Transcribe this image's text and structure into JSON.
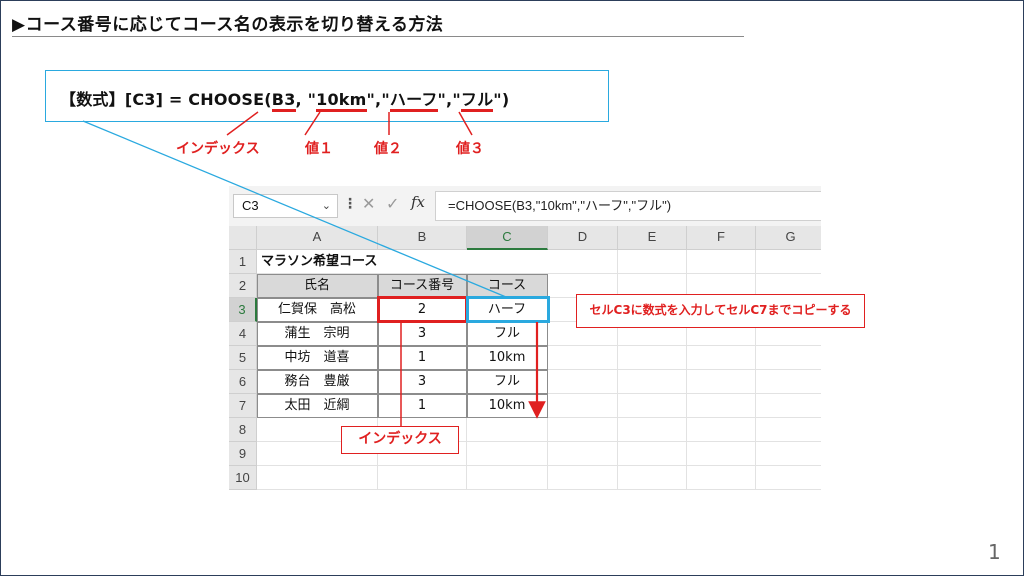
{
  "slide": {
    "title": "▶コース番号に応じてコース名の表示を切り替える方法",
    "page_number": "1"
  },
  "formula": {
    "label": "【数式】",
    "cell_ref": "[C3]",
    "equals": " = ",
    "func": "CHOOSE(",
    "arg1": "B3",
    "sep1": ", \"",
    "arg2": "10km",
    "sep2": "\",\"",
    "arg3": "ハーフ",
    "sep3": "\",\"",
    "arg4": "フル",
    "close": "\")"
  },
  "callouts": {
    "index": "インデックス",
    "value1": "値１",
    "value2": "値２",
    "value3": "値３",
    "copy_note": "セルC3に数式を入力してセルC7までコピーする",
    "index_box": "インデックス"
  },
  "colors": {
    "accent_red": "#e02020",
    "accent_blue": "#2aa9df",
    "excel_green": "#2c7a3e"
  },
  "excel": {
    "name_box": "C3",
    "name_box_dropdown_icon": "chevron-down-icon",
    "formula_bar_text": "=CHOOSE(B3,\"10km\",\"ハーフ\",\"フル\")",
    "fx_label": "fx",
    "cancel_glyph": "✕",
    "enter_glyph": "✓",
    "more_glyph": "⋮",
    "columns": [
      "A",
      "B",
      "C",
      "D",
      "E",
      "F",
      "G"
    ],
    "rows": [
      "1",
      "2",
      "3",
      "4",
      "5",
      "6",
      "7",
      "8",
      "9",
      "10"
    ],
    "sheet_title": "マラソン希望コース",
    "headers": [
      "氏名",
      "コース番号",
      "コース"
    ],
    "table": [
      [
        "仁賀保　高松",
        "2",
        "ハーフ"
      ],
      [
        "蒲生　宗明",
        "3",
        "フル"
      ],
      [
        "中坊　道喜",
        "1",
        "10km"
      ],
      [
        "務台　豊厳",
        "3",
        "フル"
      ],
      [
        "太田　近綱",
        "1",
        "10km"
      ]
    ]
  }
}
